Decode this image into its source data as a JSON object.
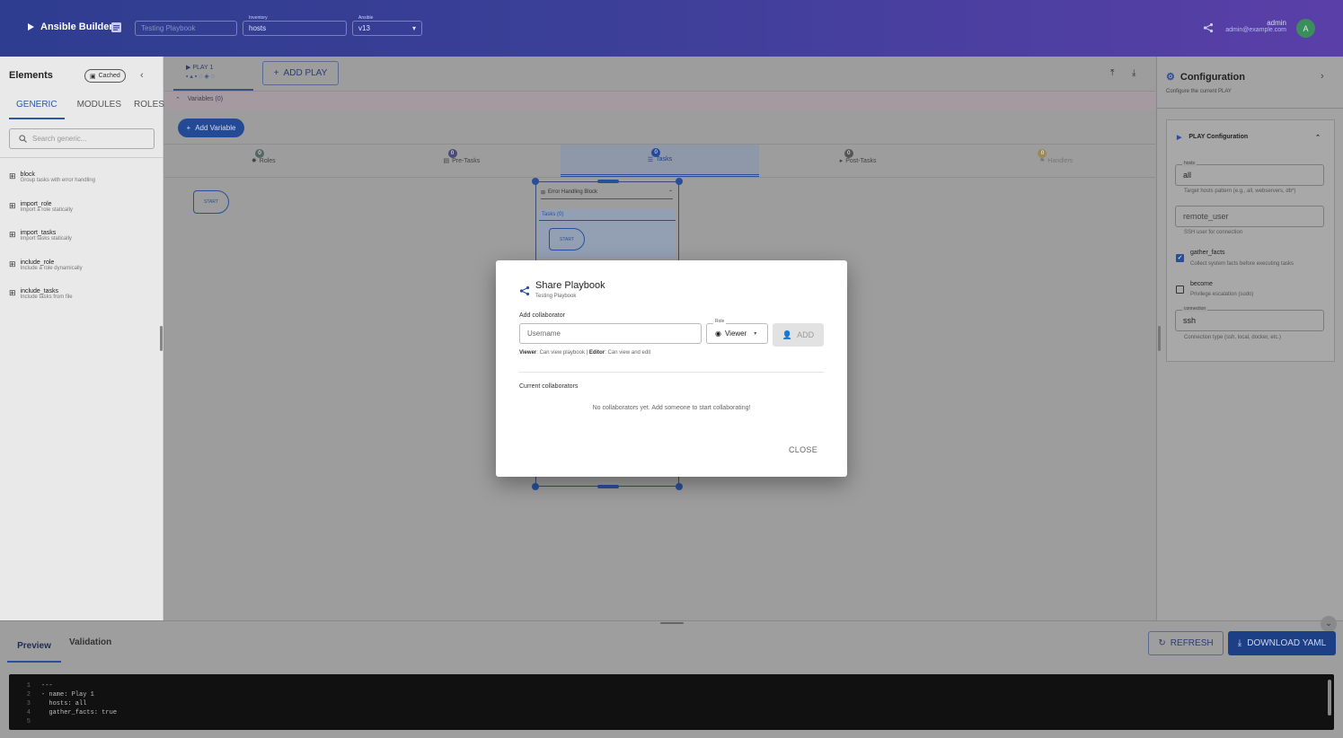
{
  "header": {
    "app_title": "Ansible Builder",
    "playbook_name": "Testing Playbook",
    "inventory_label": "Inventory",
    "inventory_value": "hosts",
    "ansible_label": "Ansible",
    "ansible_value": "v13",
    "user_name": "admin",
    "user_email": "admin@example.com",
    "avatar_letter": "A"
  },
  "left_panel": {
    "title": "Elements",
    "cached_badge": "Cached",
    "tabs": [
      "GENERIC",
      "MODULES",
      "ROLES"
    ],
    "search_placeholder": "Search generic...",
    "items": [
      {
        "name": "block",
        "desc": "Group tasks with error handling"
      },
      {
        "name": "import_role",
        "desc": "Import a role statically"
      },
      {
        "name": "import_tasks",
        "desc": "Import tasks statically"
      },
      {
        "name": "include_role",
        "desc": "Include a role dynamically"
      },
      {
        "name": "include_tasks",
        "desc": "Include tasks from file"
      }
    ]
  },
  "canvas": {
    "play_tab": "PLAY 1",
    "add_play": "ADD PLAY",
    "variables_header": "Variables (0)",
    "add_variable": "Add Variable",
    "section_tabs": [
      {
        "label": "Roles",
        "count": "0"
      },
      {
        "label": "Pre-Tasks",
        "count": "0"
      },
      {
        "label": "Tasks",
        "count": "0"
      },
      {
        "label": "Post-Tasks",
        "count": "0"
      },
      {
        "label": "Handlers",
        "count": "0"
      }
    ],
    "start_label": "START",
    "block_title": "Error Handling Block",
    "block_tasks_label": "Tasks (0)",
    "block_start_label": "START"
  },
  "right_panel": {
    "title": "Configuration",
    "subtitle": "Configure the current PLAY",
    "section_title": "PLAY Configuration",
    "hosts_label": "hosts",
    "hosts_value": "all",
    "hosts_help": "Target hosts pattern (e.g., all, webservers, db*)",
    "remote_user_placeholder": "remote_user",
    "remote_user_help": "SSH user for connection",
    "gather_facts_label": "gather_facts",
    "gather_facts_help": "Collect system facts before executing tasks",
    "gather_facts_checked": true,
    "become_label": "become",
    "become_help": "Privilege escalation (sudo)",
    "become_checked": false,
    "connection_label": "connection",
    "connection_value": "ssh",
    "connection_help": "Connection type (ssh, local, docker, etc.)"
  },
  "bottom": {
    "tabs": [
      "Preview",
      "Validation"
    ],
    "refresh_label": "REFRESH",
    "download_label": "DOWNLOAD YAML",
    "code_lines": [
      {
        "n": "1",
        "text": "---"
      },
      {
        "n": "2",
        "text": "- name: Play 1"
      },
      {
        "n": "3",
        "text": "  hosts: all"
      },
      {
        "n": "4",
        "text": "  gather_facts: true"
      },
      {
        "n": "5",
        "text": ""
      }
    ]
  },
  "modal": {
    "title": "Share Playbook",
    "subtitle": "Testing Playbook",
    "add_collaborator_label": "Add collaborator",
    "username_placeholder": "Username",
    "role_label": "Role",
    "role_value": "Viewer",
    "add_button": "ADD",
    "help_viewer_bold": "Viewer",
    "help_viewer_text": ": Can view playbook | ",
    "help_editor_bold": "Editor",
    "help_editor_text": ": Can view and edit",
    "current_collaborators_label": "Current collaborators",
    "empty_message": "No collaborators yet. Add someone to start collaborating!",
    "close_button": "CLOSE"
  },
  "colors": {
    "primary": "#1e4fa8",
    "header_start": "#2e3d8f",
    "header_end": "#5a3fa8"
  }
}
